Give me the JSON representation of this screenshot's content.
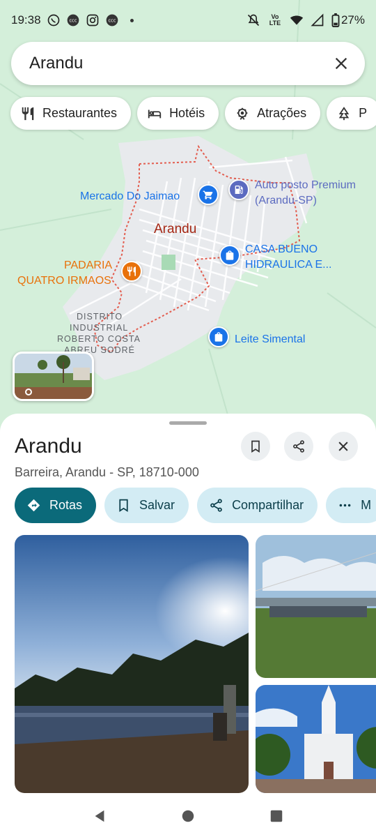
{
  "status": {
    "time": "19:38",
    "battery": "27%",
    "network": "Vo LTE",
    "icons": [
      "whatsapp-icon",
      "app-icon",
      "instagram-icon",
      "app-icon",
      "mute-icon",
      "wifi-icon",
      "signal-icon",
      "battery-icon"
    ]
  },
  "search": {
    "query": "Arandu"
  },
  "chips": [
    {
      "label": "Restaurantes",
      "icon": "fork-knife-icon"
    },
    {
      "label": "Hotéis",
      "icon": "bed-icon"
    },
    {
      "label": "Atrações",
      "icon": "ferris-wheel-icon"
    },
    {
      "label": "P",
      "icon": "tree-icon"
    }
  ],
  "map": {
    "city_label": "Arandu",
    "pois": [
      {
        "name": "Mercado Do Jaimao",
        "icon": "cart-icon",
        "color": "#1a73e8"
      },
      {
        "name_line1": "Auto posto Premium",
        "name_line2": "(Arandu-SP)",
        "icon": "fuel-icon",
        "color": "#5c6bc0"
      },
      {
        "name_line1": "CASA BUENO",
        "name_line2": "HIDRAULICA E...",
        "icon": "shopping-bag-icon",
        "color": "#1a73e8"
      },
      {
        "name_line1": "PADARIA",
        "name_line2": "QUATRO IRMAOS",
        "icon": "restaurant-icon",
        "color": "#e8710a"
      },
      {
        "name": "Leite Simental",
        "icon": "shopping-bag-icon",
        "color": "#1a73e8"
      }
    ],
    "district": {
      "line1": "DISTRITO",
      "line2": "INDUSTRIAL",
      "line3": "ROBERTO COSTA",
      "line4": "ABREU SODRÉ"
    }
  },
  "place": {
    "title": "Arandu",
    "address": "Barreira, Arandu - SP, 18710-000"
  },
  "actions": [
    {
      "label": "Rotas",
      "icon": "directions-icon"
    },
    {
      "label": "Salvar",
      "icon": "bookmark-icon"
    },
    {
      "label": "Compartilhar",
      "icon": "share-icon"
    },
    {
      "label": "M",
      "icon": "more-icon"
    }
  ],
  "colors": {
    "accent": "#0b6a7a",
    "chip_bg": "#d3ecf4",
    "map_bg": "#d6f0dc",
    "boundary": "#d93025"
  }
}
